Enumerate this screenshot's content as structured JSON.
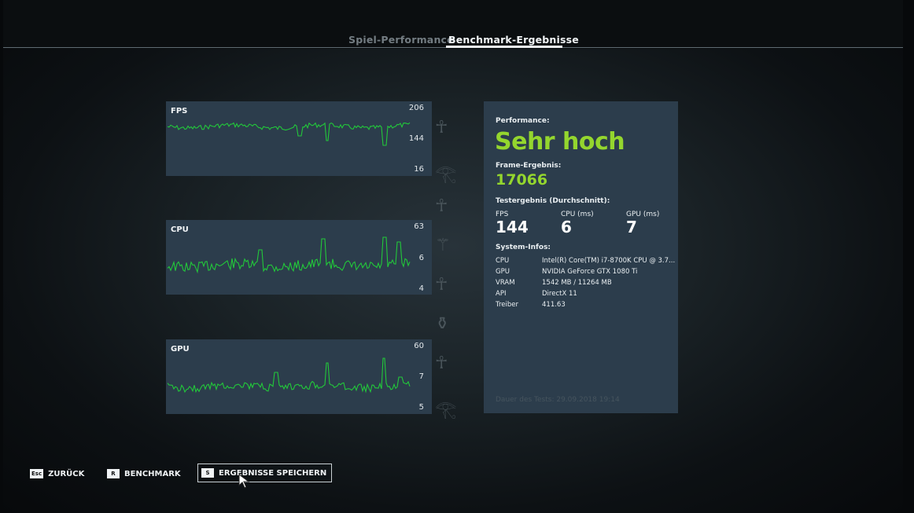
{
  "tabs": [
    {
      "label": "Spiel-Performance",
      "active": false
    },
    {
      "label": "Benchmark-Ergebnisse",
      "active": true
    }
  ],
  "graphs": [
    {
      "title": "FPS",
      "ticks": [
        "206",
        "144",
        "16"
      ]
    },
    {
      "title": "CPU",
      "ticks": [
        "63",
        "6",
        "4"
      ]
    },
    {
      "title": "GPU",
      "ticks": [
        "60",
        "7",
        "5"
      ]
    }
  ],
  "stats": {
    "performance_label": "Performance:",
    "performance_value": "Sehr hoch",
    "frame_label": "Frame-Ergebnis:",
    "frame_value": "17066",
    "avg_label": "Testergebnis (Durchschnitt):",
    "avg": [
      {
        "label": "FPS",
        "value": "144"
      },
      {
        "label": "CPU (ms)",
        "value": "6"
      },
      {
        "label": "GPU (ms)",
        "value": "7"
      }
    ],
    "system_label": "System-Infos:",
    "system": [
      {
        "key": "CPU",
        "value": "Intel(R) Core(TM) i7-8700K CPU @ 3.7..."
      },
      {
        "key": "GPU",
        "value": "NVIDIA GeForce GTX 1080 Ti"
      },
      {
        "key": "VRAM",
        "value": "1542 MB / 11264 MB"
      },
      {
        "key": "API",
        "value": "DirectX 11"
      },
      {
        "key": "Treiber",
        "value": "411.63"
      }
    ],
    "test_duration": "Dauer des Tests: 29.09.2018 19:14"
  },
  "footer": {
    "back": {
      "key": "Esc",
      "label": "ZURÜCK"
    },
    "benchmark": {
      "key": "R",
      "label": "BENCHMARK"
    },
    "save": {
      "key": "S",
      "label": "ERGEBNISSE SPEICHERN"
    }
  },
  "colors": {
    "accent_green": "#94d62e",
    "graph_line": "#22c83a",
    "panel_bg": "#2c3d4c"
  },
  "icons": [
    "mouse-cursor-icon"
  ]
}
